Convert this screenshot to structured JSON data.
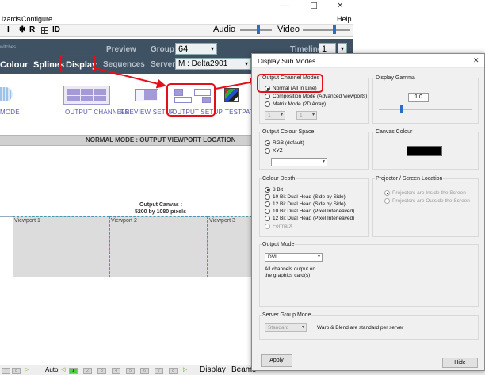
{
  "menubar": {
    "item1": "izards",
    "item2": "Configure",
    "help": "Help"
  },
  "window_controls": {
    "minimize": "—",
    "maximize": "☐",
    "close": "✕"
  },
  "toolbar": {
    "buttons": [
      "I",
      "✱",
      "R",
      "ID"
    ],
    "audio_label": "Audio",
    "video_label": "Video",
    "timeline_label": "Timeline",
    "timeline_value": "1"
  },
  "nav": {
    "preview": "Preview",
    "group_label": "Group",
    "group_value": "64",
    "colour": "Colour",
    "splines": "Splines",
    "display": "Display",
    "sequences": "Sequences",
    "server_label": "Server",
    "server_value": "M : Delta2901",
    "switches": "witches"
  },
  "tools": {
    "mode": "MODE",
    "output_channels": "OUTPUT CHANNELS",
    "preview_setup": "PREVIEW SETUP",
    "output_setup": "OUTPUT SETUP",
    "testpattern": "TESTPATTE"
  },
  "main": {
    "section_title": "NORMAL MODE : OUTPUT VIEWPORT LOCATION",
    "canvas_label": "Output Canvas :",
    "canvas_size": "5200 by 1080 pixels",
    "viewports": [
      "Viewport 1",
      "Viewport 2",
      "Viewport 3"
    ]
  },
  "statusbar": {
    "left_items": [
      "7",
      "8"
    ],
    "auto": "Auto",
    "segments": [
      "1",
      "2",
      "3",
      "4",
      "5",
      "6",
      "7",
      "8"
    ],
    "display": "Display",
    "beams": "Beams"
  },
  "dialog": {
    "title": "Display Sub Modes",
    "output_channel_modes": {
      "title": "Output Channel Modes",
      "options": [
        "Normal    (All In Line)",
        "Composition Mode (Advanced Viewports)",
        "Matrix Mode  (2D Array)"
      ],
      "selected_index": 0,
      "matrix_cols": "1",
      "matrix_rows": "1"
    },
    "display_gamma": {
      "title": "Display Gamma",
      "value": "1.0"
    },
    "output_colour_space": {
      "title": "Output Colour Space",
      "options": [
        "RGB (default)",
        "XYZ"
      ],
      "selected_index": 0
    },
    "canvas_colour": {
      "title": "Canvas Colour",
      "color": "#000000"
    },
    "colour_depth": {
      "title": "Colour Depth",
      "options": [
        "8 Bit",
        "10 Bit Dual Head (Side by Side)",
        "12 Bit Dual Head (Side by Side)",
        "10 Bit Dual Head (Pixel Interleaved)",
        "12 Bit Dual Head (Pixel Interleaved)",
        "FormatX"
      ],
      "selected_index": 0
    },
    "projector_location": {
      "title": "Projector / Screen Location",
      "options": [
        "Projectors are Inside the Screen",
        "Projectors are Outside the Screen"
      ],
      "selected_index": 0
    },
    "output_mode": {
      "title": "Output Mode",
      "value": "DVI",
      "description_line1": "All channels output on",
      "description_line2": "the graphics card(s)"
    },
    "server_group_mode": {
      "title": "Server Group Mode",
      "value": "Standard",
      "description": "Warp & Blend are standard per server"
    },
    "apply_button": "Apply",
    "hide_button": "Hide",
    "close_icon": "✕"
  }
}
